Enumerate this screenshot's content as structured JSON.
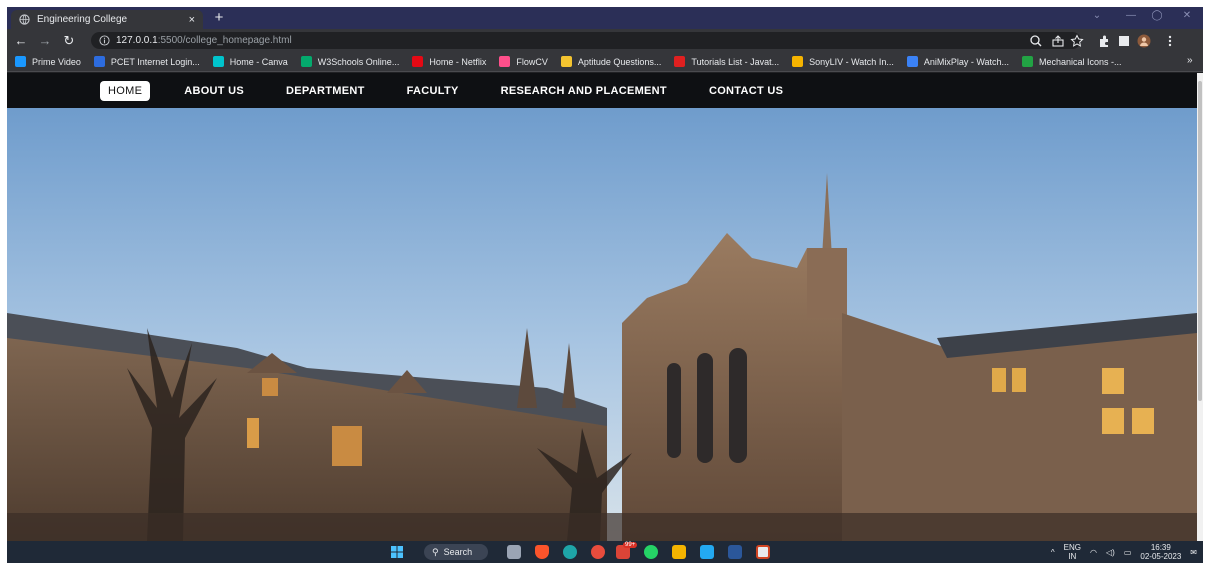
{
  "browser": {
    "tab_title": "Engineering College",
    "tab_close": "×",
    "new_tab": "+",
    "url_host": "127.0.0.1",
    "url_path": ":5500/college_homepage.html"
  },
  "bookmarks": [
    {
      "label": "Prime Video",
      "color": "#1a98ff"
    },
    {
      "label": "PCET Internet Login...",
      "color": "#2d6cdf"
    },
    {
      "label": "Home - Canva",
      "color": "#00c4cc"
    },
    {
      "label": "W3Schools Online...",
      "color": "#04aa6d"
    },
    {
      "label": "Home - Netflix",
      "color": "#e50914"
    },
    {
      "label": "FlowCV",
      "color": "#ff4f8b"
    },
    {
      "label": "Aptitude Questions...",
      "color": "#f4c430"
    },
    {
      "label": "Tutorials List - Javat...",
      "color": "#e02020"
    },
    {
      "label": "SonyLIV - Watch In...",
      "color": "#f6b400"
    },
    {
      "label": "AniMixPlay - Watch...",
      "color": "#3b82f6"
    },
    {
      "label": "Mechanical Icons -...",
      "color": "#22a344"
    }
  ],
  "bookmarks_more": "»",
  "site_nav": {
    "items": [
      "HOME",
      "ABOUT US",
      "DEPARTMENT",
      "FACULTY",
      "RESEARCH AND PLACEMENT",
      "CONTACT US"
    ]
  },
  "taskbar": {
    "search_label": "Search",
    "lang_top": "ENG",
    "lang_bottom": "IN",
    "time": "16:39",
    "date": "02-05-2023",
    "badge": "99+"
  },
  "colors": {
    "nav_bg": "#0e1013",
    "sky": "#7aa9d8",
    "stone": "#6e5643"
  }
}
